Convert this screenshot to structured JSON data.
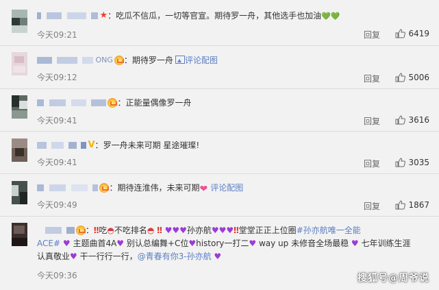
{
  "comments": [
    {
      "username_visible": "",
      "text": "吃瓜不信瓜，一切等官宣。期待罗一舟，其他选手也加油",
      "time": "今天09:21",
      "reply_label": "回复",
      "likes": "6419"
    },
    {
      "username_visible": "ONG",
      "text": "期待罗一舟",
      "extra_link": "评论配图",
      "time": "今天09:12",
      "reply_label": "回复",
      "likes": "5006"
    },
    {
      "username_visible": "",
      "text": "正能量偶像罗一舟",
      "time": "今天09:41",
      "reply_label": "回复",
      "likes": "3616"
    },
    {
      "username_visible": "",
      "text": "罗一舟未来可期 星途璀璨!",
      "time": "今天09:41",
      "reply_label": "回复",
      "likes": "3035"
    },
    {
      "username_visible": "",
      "text": "期待连淮伟，未来可期",
      "extra_link": "评论配图",
      "time": "今天09:49",
      "reply_label": "回复",
      "likes": "1867"
    },
    {
      "username_visible": "",
      "line1_a": "吃",
      "line1_b": "不吃排名",
      "line1_c": "孙亦航",
      "line1_d": "堂堂正正上位圈",
      "line1_tag": "#孙亦航唯一全能",
      "line2_tag": "ACE#",
      "line2_a": "主题曲首4A",
      "line2_b": "别认总编舞+C位",
      "line2_c": "history一打二",
      "line2_d": "way up 未修音全场最稳",
      "line2_e": "七年训练生涯",
      "line3_a": "认真敬业",
      "line3_b": "干一行行一行，",
      "line3_mention": "@青春有你3-孙亦航",
      "time": "今天09:36"
    }
  ],
  "watermark": "搜狐号@周爷说",
  "colors": {
    "link": "#5b7ec4",
    "username": "#7e92b8",
    "background": "#f2f2f2",
    "separator": "#dcdcdc"
  }
}
